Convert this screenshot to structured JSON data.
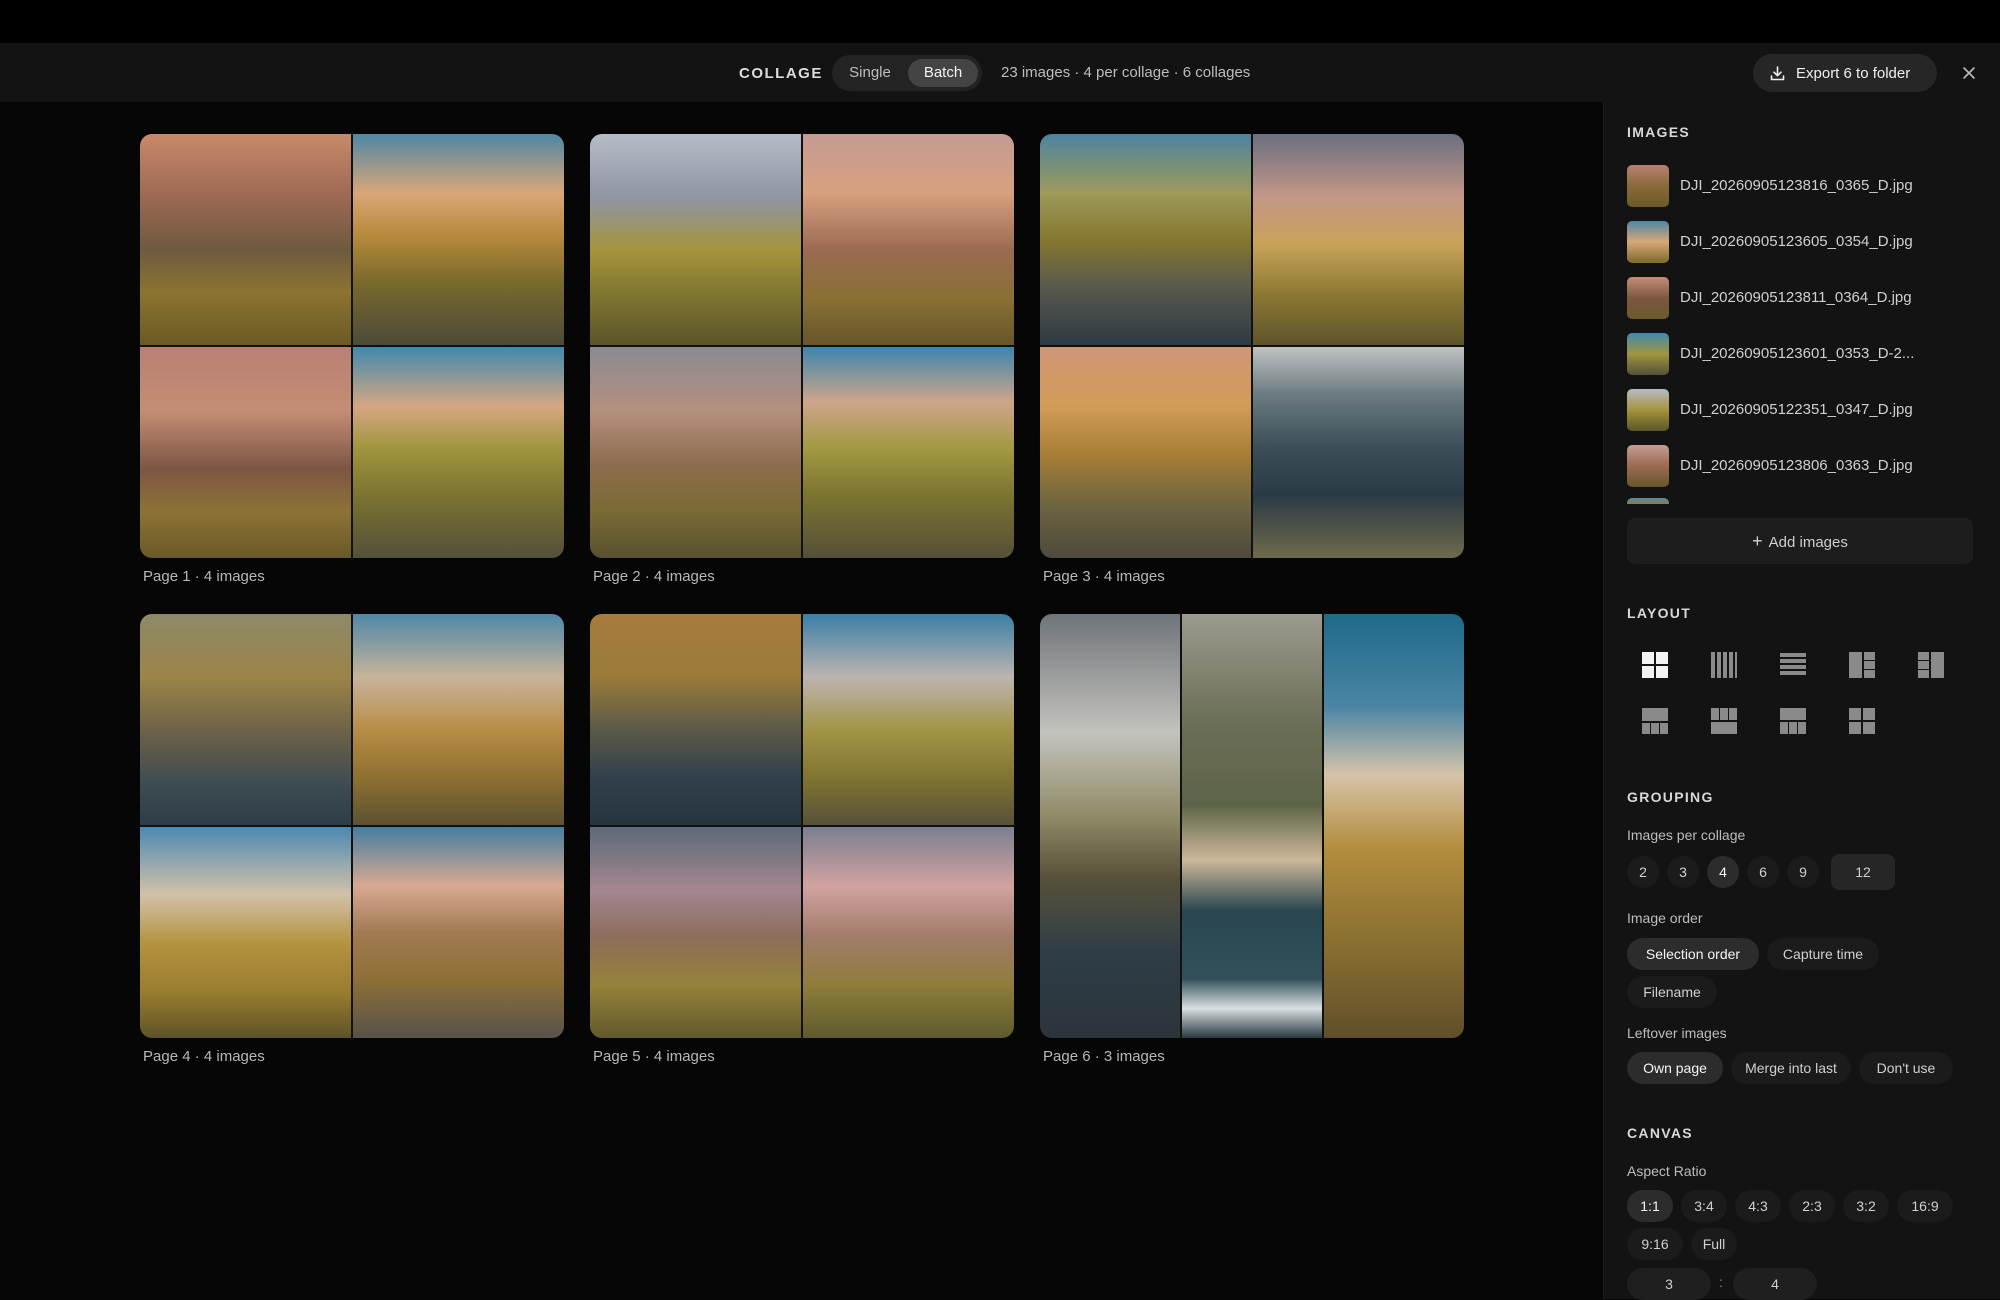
{
  "toolbar": {
    "title": "COLLAGE",
    "modes": [
      "Single",
      "Batch"
    ],
    "active_mode": "Batch",
    "info": "23 images · 4 per collage · 6 collages",
    "export_label": "Export 6 to folder",
    "icons": {
      "export": "download-icon",
      "close": "close-icon"
    }
  },
  "collages": [
    {
      "caption": "Page 1 · 4 images",
      "layout": "grid-2x2"
    },
    {
      "caption": "Page 2 · 4 images",
      "layout": "grid-2x2"
    },
    {
      "caption": "Page 3 · 4 images",
      "layout": "grid-2x2"
    },
    {
      "caption": "Page 4 · 4 images",
      "layout": "grid-2x2"
    },
    {
      "caption": "Page 5 · 4 images",
      "layout": "grid-2x2"
    },
    {
      "caption": "Page 6 · 3 images",
      "layout": "columns-3"
    }
  ],
  "sidebar": {
    "images": {
      "title": "IMAGES",
      "files": [
        "DJI_20260905123816_0365_D.jpg",
        "DJI_20260905123605_0354_D.jpg",
        "DJI_20260905123811_0364_D.jpg",
        "DJI_20260905123601_0353_D-2...",
        "DJI_20260905122351_0347_D.jpg",
        "DJI_20260905123806_0363_D.jpg"
      ],
      "add_label": "Add images"
    },
    "layout": {
      "title": "LAYOUT",
      "icons": [
        "grid-2x2-icon",
        "columns-icon",
        "rows-icon",
        "feature-left-icon",
        "feature-right-icon",
        "feature-top-icon",
        "grid-3x2-icon",
        "feature-bottom-icon",
        "mosaic-icon"
      ],
      "selected": "grid-2x2-icon"
    },
    "grouping": {
      "title": "GROUPING",
      "per_collage_label": "Images per collage",
      "per_collage_options": [
        "2",
        "3",
        "4",
        "6",
        "9",
        "12"
      ],
      "per_collage_selected": "4",
      "order_label": "Image order",
      "order_options": [
        "Selection order",
        "Capture time",
        "Filename"
      ],
      "order_selected": "Selection order",
      "leftover_label": "Leftover images",
      "leftover_options": [
        "Own page",
        "Merge into last",
        "Don't use"
      ],
      "leftover_selected": "Own page"
    },
    "canvas": {
      "title": "CANVAS",
      "aspect_label": "Aspect Ratio",
      "aspect_options": [
        "1:1",
        "3:4",
        "4:3",
        "2:3",
        "3:2",
        "16:9",
        "9:16",
        "Full"
      ],
      "aspect_selected": "1:1",
      "custom_w": "3",
      "custom_sep": ":",
      "custom_h": "4"
    }
  }
}
